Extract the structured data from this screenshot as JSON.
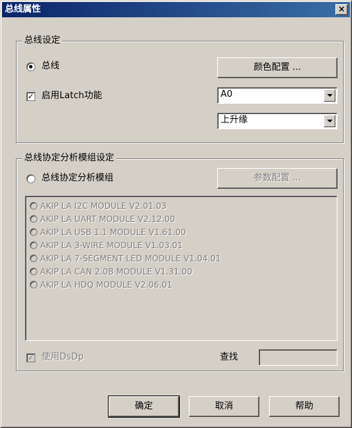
{
  "window": {
    "title": "总线属性",
    "close_label": "×"
  },
  "bus_group": {
    "legend": "总线设定",
    "bus_radio_label": "总线",
    "color_button": "颜色配置 ...",
    "latch_label": "启用Latch功能",
    "latch_checked": true,
    "latch_check_mark": "✓",
    "channel_value": "A0",
    "edge_value": "上升缘"
  },
  "protocol_group": {
    "legend": "总线协定分析模组设定",
    "protocol_radio_label": "总线协定分析模组",
    "param_button": "参数配置 ...",
    "modules": [
      "AKIP LA I2C MODULE V2.01.03",
      "AKIP LA UART MODULE V2.12.00",
      "AKIP LA USB 1.1 MODULE V1.61.00",
      "AKIP LA 3-WIRE MODULE V1.03.01",
      "AKIP LA 7-SEGMENT LED MODULE V1.04.01",
      "AKIP LA CAN 2.0B MODULE V1.31.00",
      "AKIP LA HDQ MODULE V2.06.01"
    ],
    "dsdp_label": "使用DsDp",
    "dsdp_check_mark": "✓",
    "search_label": "查找",
    "search_value": ""
  },
  "footer": {
    "ok": "确定",
    "cancel": "取消",
    "help": "帮助"
  }
}
